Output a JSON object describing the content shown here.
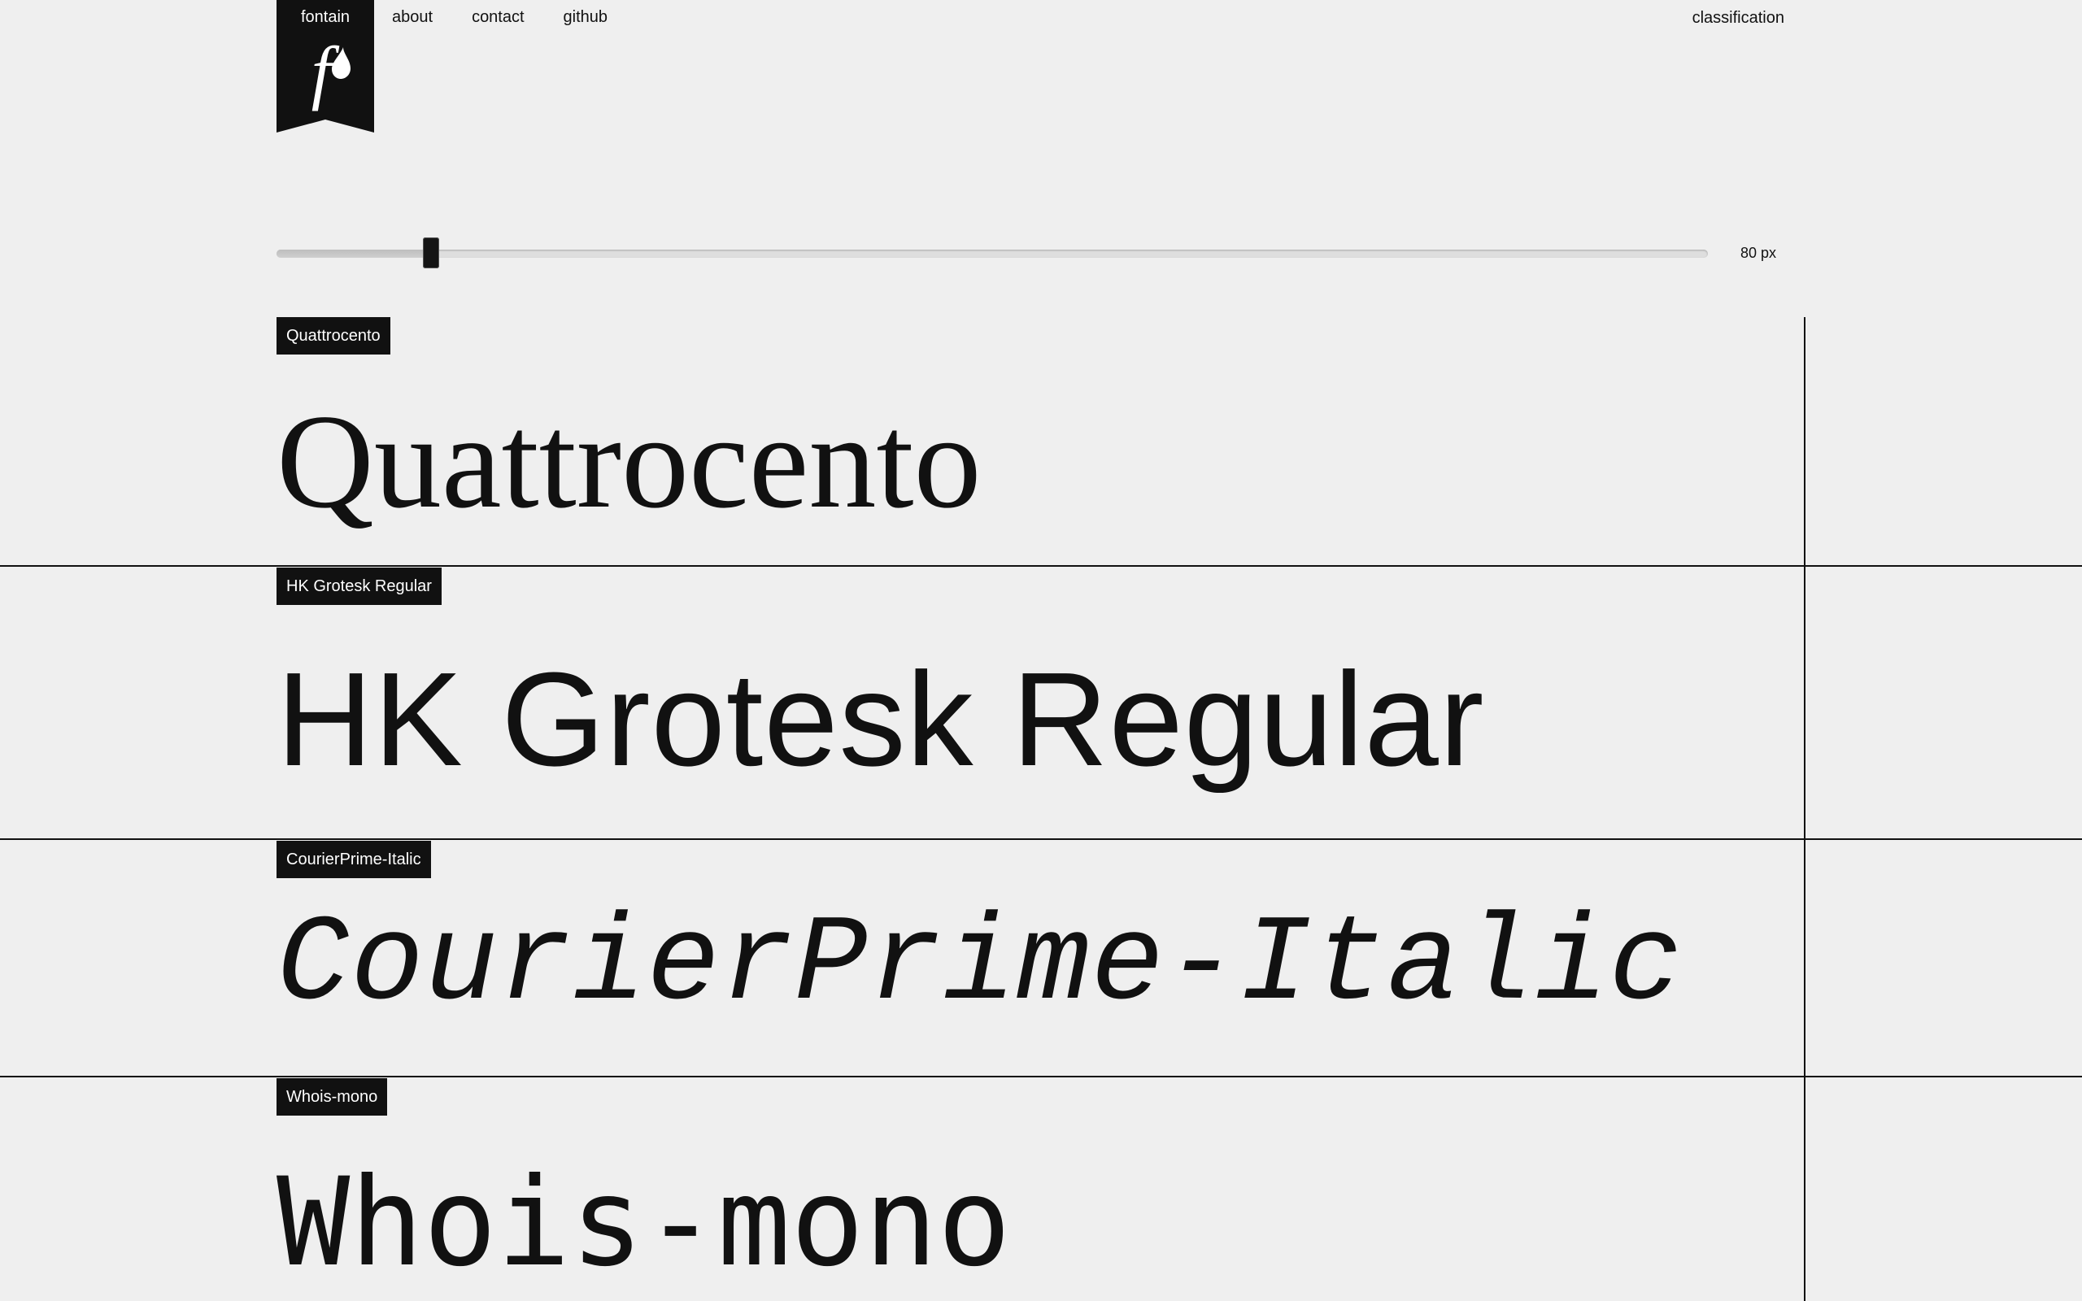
{
  "header": {
    "logo_label": "fontain",
    "nav": [
      "about",
      "contact",
      "github"
    ],
    "right_link": "classification"
  },
  "size_control": {
    "value_label": "80 px",
    "level_fraction": 0.108
  },
  "fonts": [
    {
      "tag": "Quattrocento",
      "sample": "Quattrocento"
    },
    {
      "tag": "HK Grotesk Regular",
      "sample": "HK Grotesk Regular"
    },
    {
      "tag": "CourierPrime-Italic",
      "sample": "CourierPrime-Italic"
    },
    {
      "tag": "Whois-mono",
      "sample": "Whois-mono"
    }
  ]
}
